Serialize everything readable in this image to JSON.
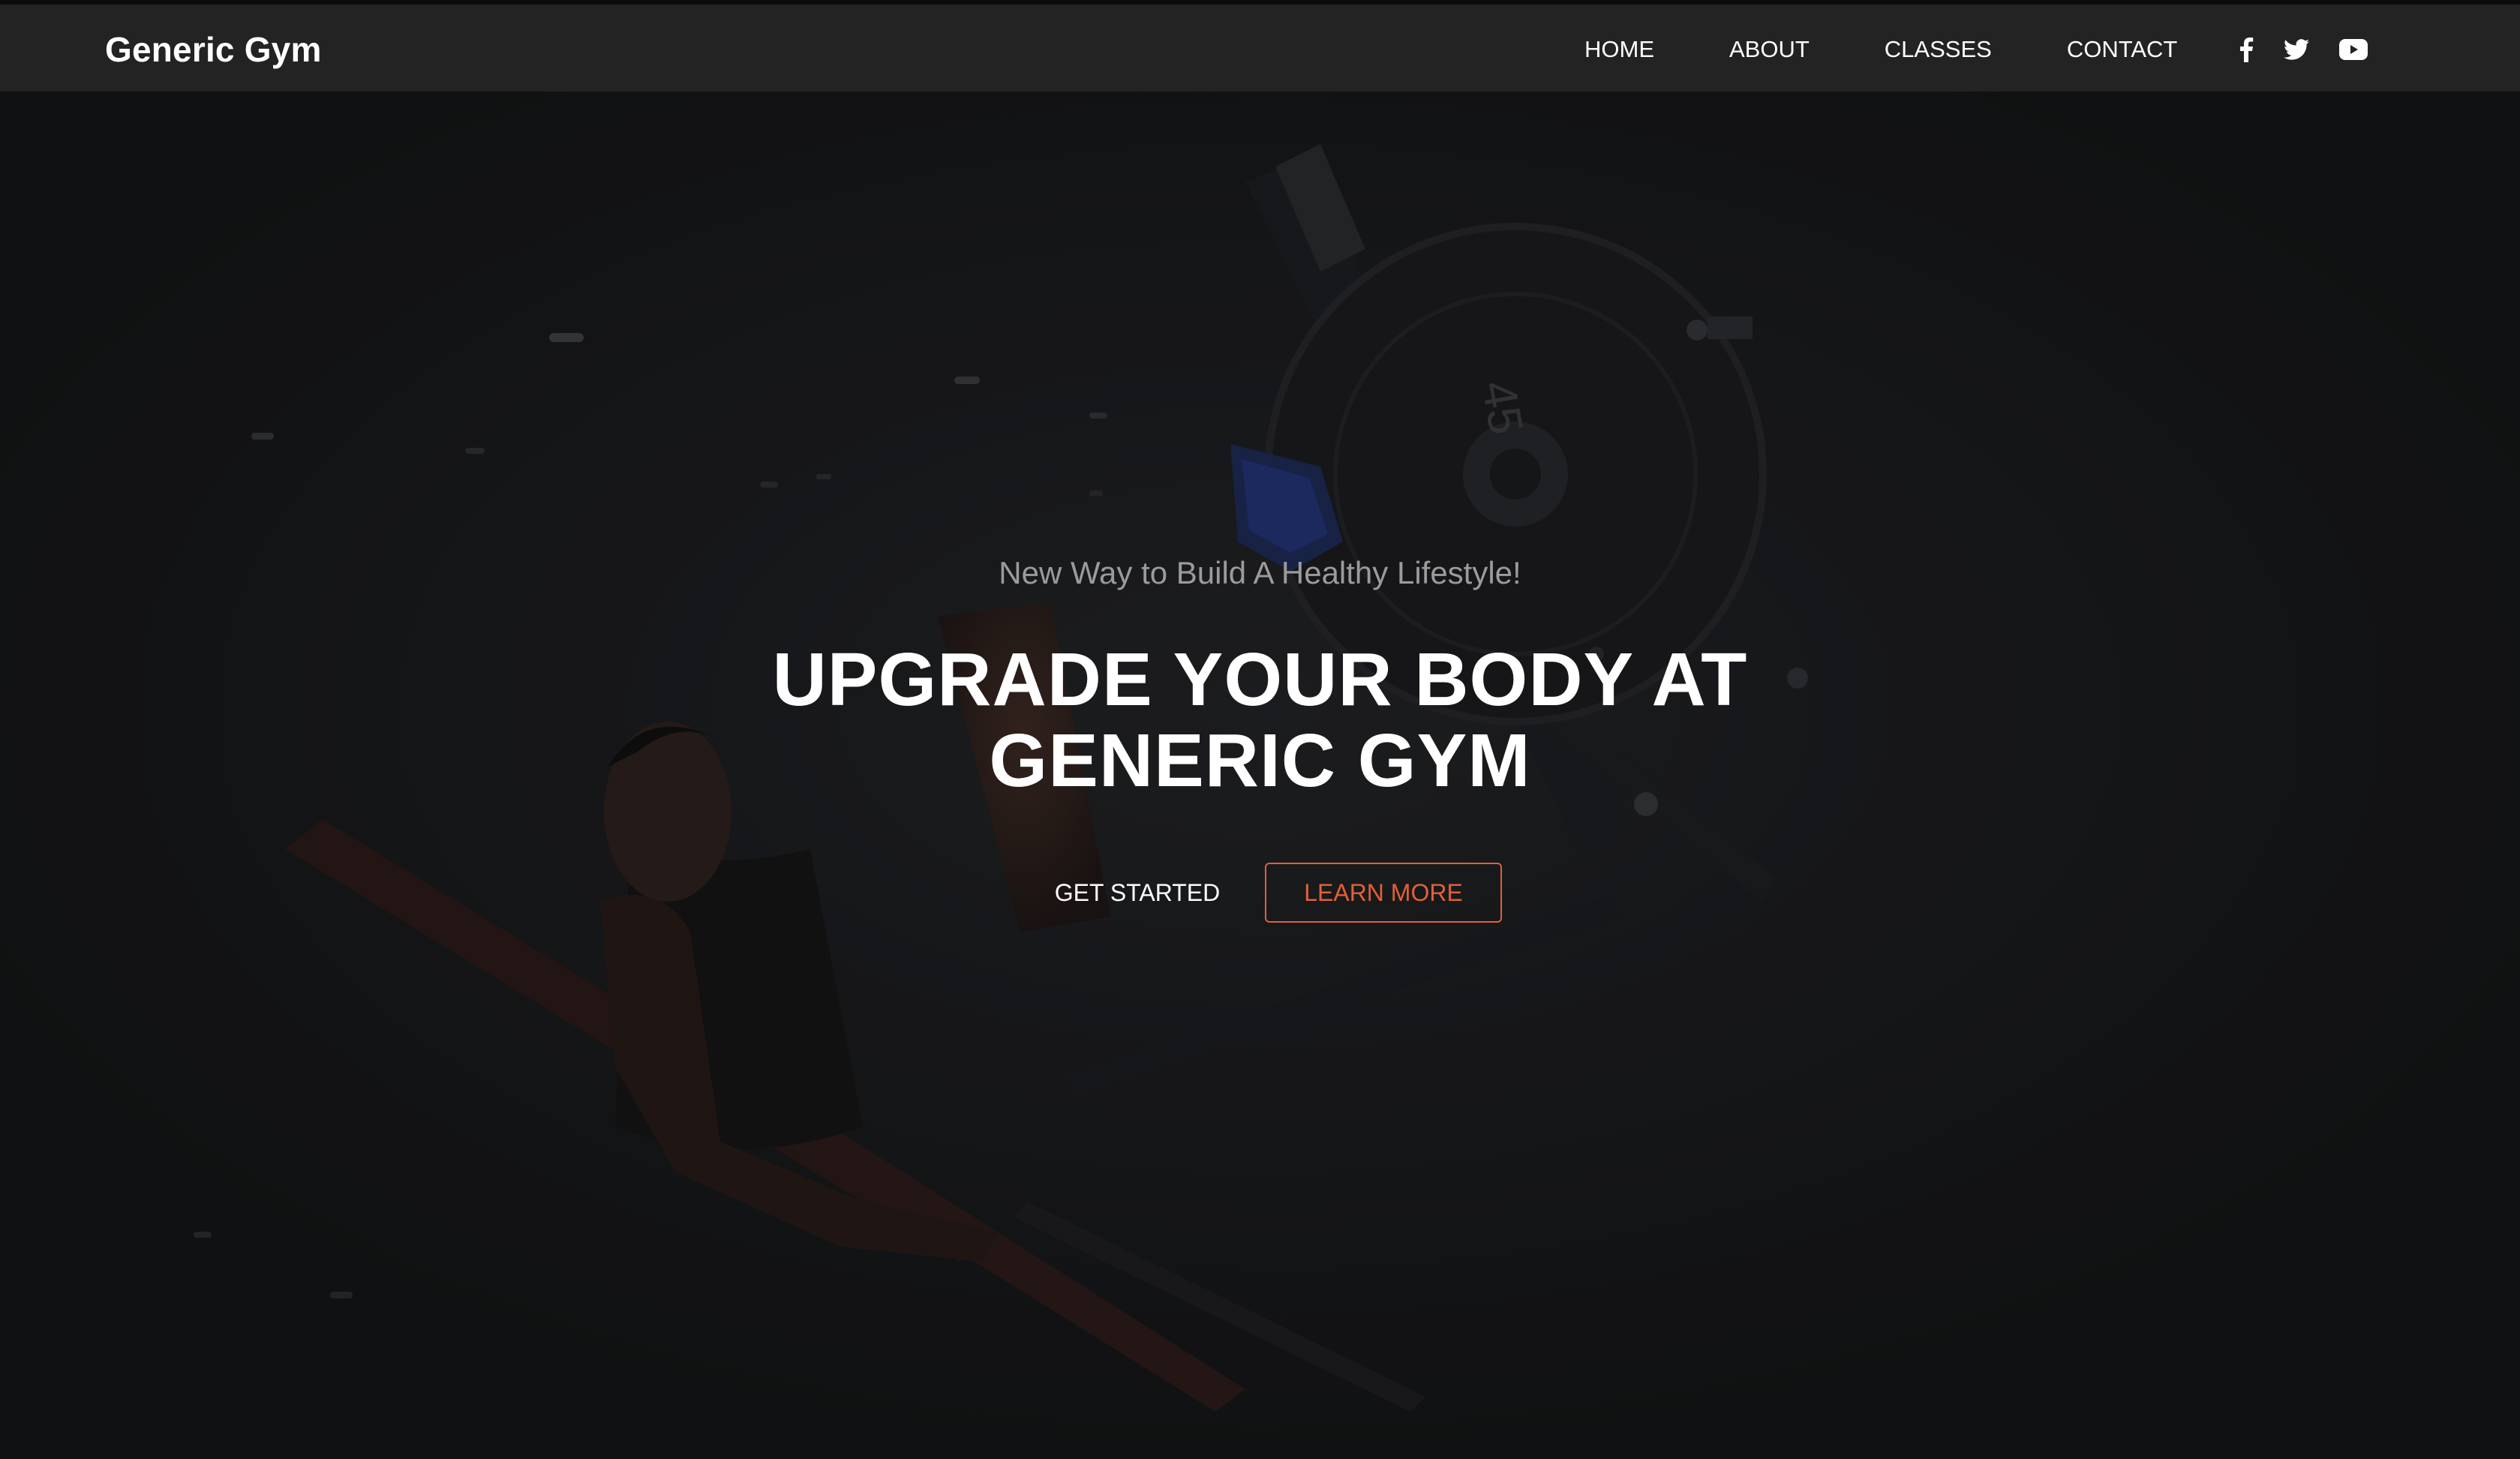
{
  "brand": {
    "name": "Generic Gym"
  },
  "nav": {
    "items": [
      {
        "label": "HOME"
      },
      {
        "label": "ABOUT"
      },
      {
        "label": "CLASSES"
      },
      {
        "label": "CONTACT"
      }
    ],
    "social": [
      {
        "icon": "facebook-icon"
      },
      {
        "icon": "twitter-icon"
      },
      {
        "icon": "youtube-icon"
      }
    ]
  },
  "hero": {
    "subtitle": "New Way to Build A Healthy Lifestyle!",
    "headline_line1": "UPGRADE YOUR BODY AT",
    "headline_line2": "GENERIC GYM",
    "primary_button": "GET STARTED",
    "secondary_button": "LEARN MORE",
    "plate_marking": "45"
  },
  "colors": {
    "navbar": "#232323",
    "background": "#17181a",
    "accent": "#e0603a",
    "subtitle": "#9b9b9b",
    "text": "#ffffff"
  }
}
